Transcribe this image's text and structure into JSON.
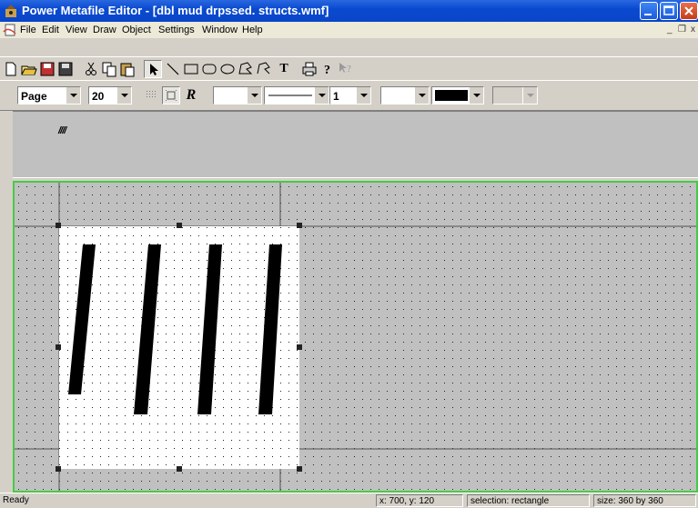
{
  "window": {
    "title": "Power Metafile Editor - [dbl mud drpssed. structs.wmf]"
  },
  "menu": {
    "items": [
      "File",
      "Edit",
      "View",
      "Draw",
      "Object",
      "Settings",
      "Window",
      "Help"
    ]
  },
  "toolbar1": {
    "icons": [
      "new-icon",
      "open-icon",
      "save-icon",
      "save-as-icon",
      "cut-icon",
      "copy-icon",
      "paste-icon",
      "select-arrow-icon",
      "line-icon",
      "rectangle-icon",
      "rounded-rectangle-icon",
      "ellipse-icon",
      "polygon-icon",
      "polyline-icon",
      "text-tool-icon",
      "print-icon",
      "help-icon",
      "context-help-icon"
    ],
    "text_tool_label": "T"
  },
  "toolbar2": {
    "page_combo": "Page",
    "zoom_combo": "20",
    "rotate_label": "R",
    "line_width_combo": "1"
  },
  "preview": {
    "thumbnail_text": "////"
  },
  "status": {
    "ready": "Ready",
    "coords": "x: 700, y: 120",
    "selection": "selection: rectangle",
    "size": "size: 360 by 360"
  },
  "colors": {
    "title_bar": "#0a4ad0",
    "canvas_border": "#44cc44",
    "selection_fill": "#ffffff",
    "fill_color_swatch": "#000000"
  }
}
